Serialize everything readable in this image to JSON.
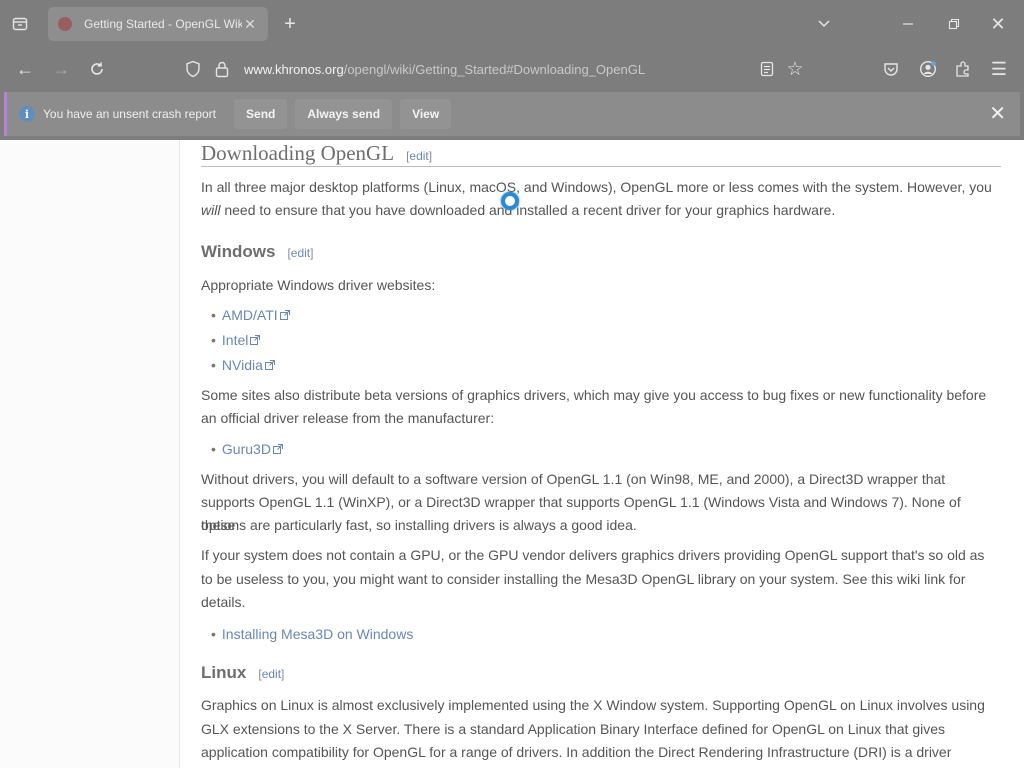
{
  "browser": {
    "tab": {
      "title": "Getting Started - OpenGL Wiki"
    },
    "url": {
      "domain": "www.khronos.org",
      "path": "/opengl/wiki/Getting_Started#Downloading_OpenGL"
    }
  },
  "notification": {
    "message": "You have an unsent crash report",
    "send": "Send",
    "always_send": "Always send",
    "view": "View"
  },
  "article": {
    "heading": "Downloading OpenGL",
    "edit_label": "edit",
    "intro_1": "In all three major desktop platforms (Linux, macOS, and Windows), OpenGL more or less comes with the system. However, you",
    "intro_will": "will",
    "intro_2": " need to ensure that you have downloaded and installed a recent driver for your graphics hardware.",
    "windows": {
      "heading": "Windows",
      "lead": "Appropriate Windows driver websites:",
      "links": [
        "AMD/ATI",
        "Intel",
        "NVidia"
      ],
      "beta_1": "Some sites also distribute beta versions of graphics drivers, which may give you access to bug fixes or new functionality before",
      "beta_2": "an official driver release from the manufacturer:",
      "beta_link": "Guru3D",
      "nodriver_1": "Without drivers, you will default to a software version of OpenGL 1.1 (on Win98, ME, and 2000), a Direct3D wrapper that",
      "nodriver_2": "supports OpenGL 1.1 (WinXP), or a Direct3D wrapper that supports OpenGL 1.1 (Windows Vista and Windows 7). None of these",
      "nodriver_3": "options are particularly fast, so installing drivers is always a good idea.",
      "nogpu_1": "If your system does not contain a GPU, or the GPU vendor delivers graphics drivers providing OpenGL support that's so old as",
      "nogpu_2": "to be useless to you, you might want to consider installing the Mesa3D OpenGL library on your system. See this wiki link for",
      "nogpu_3": "details.",
      "mesa_link": "Installing Mesa3D on Windows"
    },
    "linux": {
      "heading": "Linux",
      "p_1": "Graphics on Linux is almost exclusively implemented using the X Window system. Supporting OpenGL on Linux involves using",
      "p_2": "GLX extensions to the X Server. There is a standard Application Binary Interface defined for OpenGL on Linux that gives",
      "p_3": "application compatibility for OpenGL for a range of drivers. In addition the Direct Rendering Infrastructure (DRI) is a driver"
    }
  },
  "colors": {
    "link": "#6a87b5",
    "chrome": "#7d7d7d",
    "notification_accent": "#b97fd9"
  }
}
